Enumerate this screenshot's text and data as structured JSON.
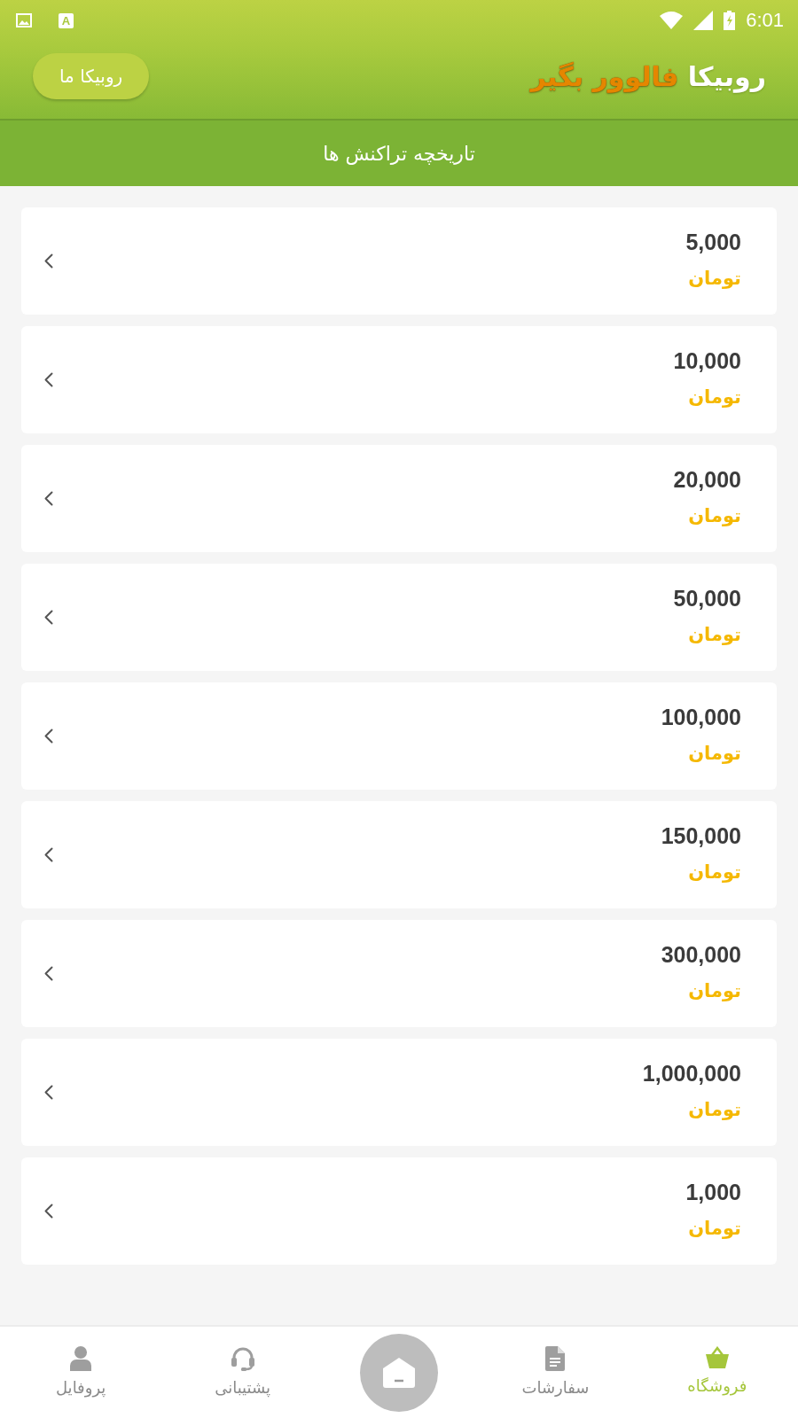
{
  "status_bar": {
    "notification_letter": "A",
    "time": "6:01"
  },
  "header": {
    "title": [
      {
        "text": "روبیکا",
        "kind": "plain"
      },
      {
        "text": "فالوور بگیر",
        "kind": "accent"
      }
    ],
    "button": "روبیکا ما"
  },
  "page_title": "تاریخچه تراکنش ها",
  "transactions": [
    {
      "amount": "5,000",
      "currency": "تومان"
    },
    {
      "amount": "10,000",
      "currency": "تومان"
    },
    {
      "amount": "20,000",
      "currency": "تومان"
    },
    {
      "amount": "50,000",
      "currency": "تومان"
    },
    {
      "amount": "100,000",
      "currency": "تومان"
    },
    {
      "amount": "150,000",
      "currency": "تومان"
    },
    {
      "amount": "300,000",
      "currency": "تومان"
    },
    {
      "amount": "1,000,000",
      "currency": "تومان"
    },
    {
      "amount": "1,000",
      "currency": "تومان"
    }
  ],
  "bottom_nav": [
    {
      "kind": "tab",
      "label": "فروشگاه",
      "selected": true
    },
    {
      "kind": "tab",
      "label": "سفارشات",
      "selected": false
    },
    {
      "kind": "home",
      "selected": false
    },
    {
      "kind": "tab",
      "label": "پشتیبانی",
      "selected": false
    },
    {
      "kind": "tab",
      "label": "پروفایل",
      "selected": false
    }
  ]
}
